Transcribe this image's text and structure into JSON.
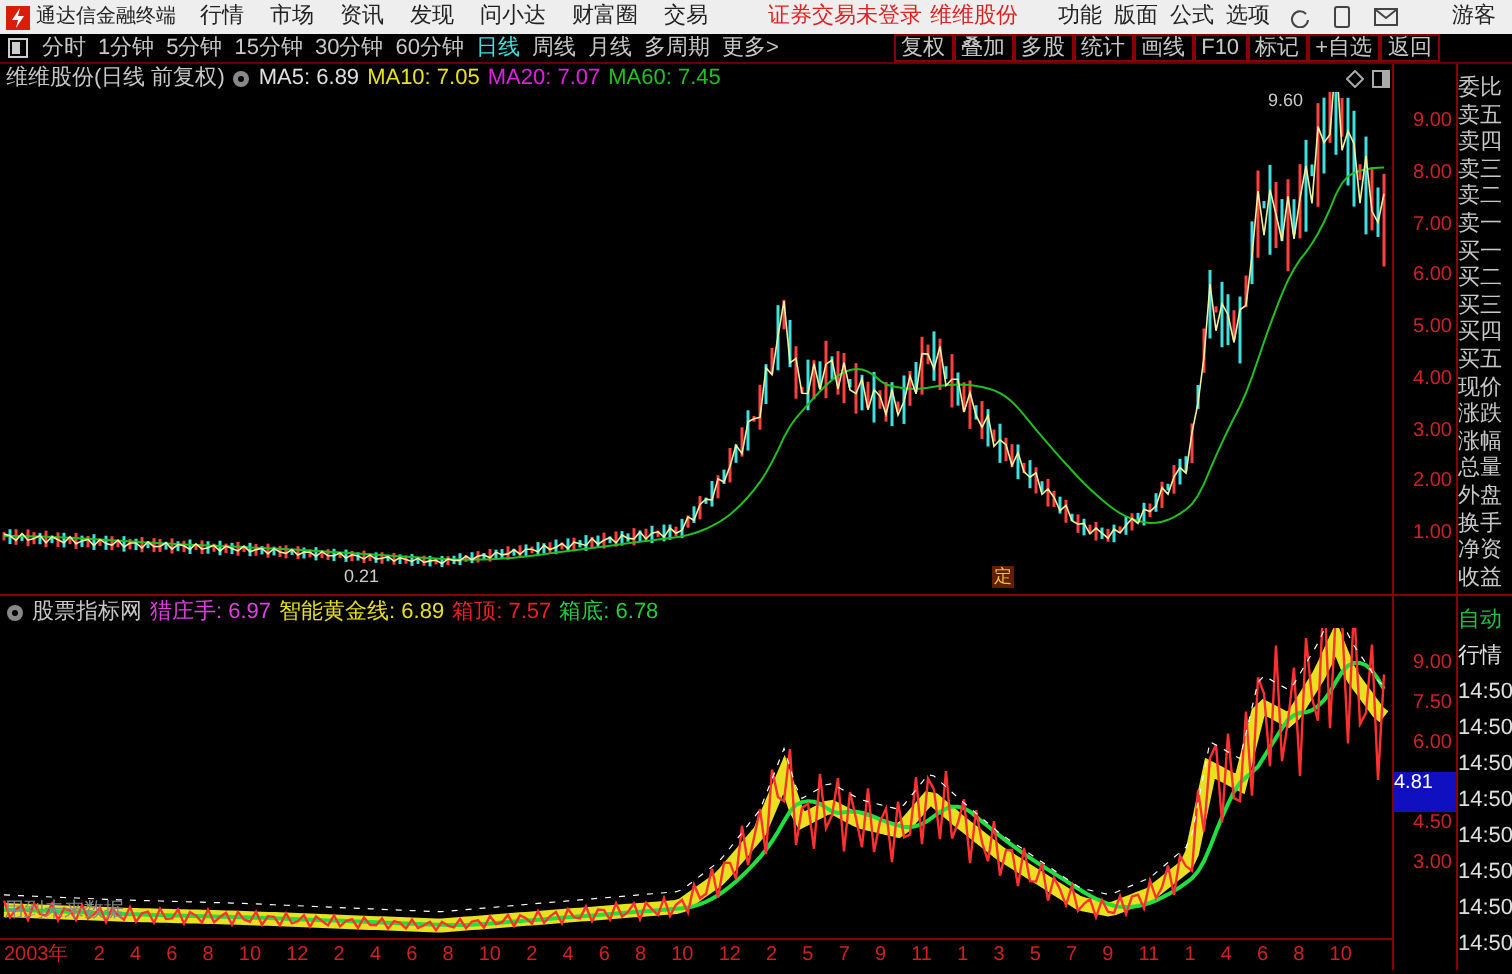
{
  "app": {
    "title": "通达信金融终端",
    "menu": [
      "行情",
      "市场",
      "资讯",
      "发现",
      "问小达",
      "财富圈",
      "交易"
    ],
    "status": "证券交易未登录",
    "stock": "维维股份",
    "tools": [
      "功能",
      "版面",
      "公式",
      "选项"
    ],
    "user": "游客"
  },
  "periods": [
    {
      "label": "分时",
      "selected": false
    },
    {
      "label": "1分钟",
      "selected": false
    },
    {
      "label": "5分钟",
      "selected": false
    },
    {
      "label": "15分钟",
      "selected": false
    },
    {
      "label": "30分钟",
      "selected": false
    },
    {
      "label": "60分钟",
      "selected": false
    },
    {
      "label": "日线",
      "selected": true
    },
    {
      "label": "周线",
      "selected": false
    },
    {
      "label": "月线",
      "selected": false
    },
    {
      "label": "多周期",
      "selected": false
    },
    {
      "label": "更多>",
      "selected": false
    }
  ],
  "actions": [
    "复权",
    "叠加",
    "多股",
    "统计",
    "画线",
    "F10",
    "标记",
    "+自选",
    "返回"
  ],
  "main_chart": {
    "title": "维维股份(日线 前复权)",
    "legend": [
      {
        "name": "MA5:",
        "value": "6.89",
        "color": "#e0e0e0"
      },
      {
        "name": "MA10:",
        "value": "7.05",
        "color": "#e8e020"
      },
      {
        "name": "MA20:",
        "value": "7.07",
        "color": "#e020e0"
      },
      {
        "name": "MA60:",
        "value": "7.45",
        "color": "#20c020"
      }
    ],
    "high_label": "9.60",
    "low_label": "0.21",
    "event_marker": "定",
    "yticks": [
      "9.00",
      "8.00",
      "7.00",
      "6.00",
      "5.00",
      "4.00",
      "3.00",
      "2.00",
      "1.00"
    ]
  },
  "quote_panel": [
    "委比",
    "卖五",
    "卖四",
    "卖三",
    "卖二",
    "卖一",
    "买一",
    "买二",
    "买三",
    "买四",
    "买五",
    "现价",
    "涨跌",
    "涨幅",
    "总量",
    "外盘",
    "换手",
    "净资",
    "收益"
  ],
  "indicator": {
    "source": "股票指标网",
    "legend": [
      {
        "name": "猎庄手:",
        "value": "6.97",
        "color": "#e040e0"
      },
      {
        "name": "智能黄金线:",
        "value": "6.89",
        "color": "#e8e020"
      },
      {
        "name": "箱顶:",
        "value": "7.57",
        "color": "#f02020"
      },
      {
        "name": "箱底:",
        "value": "6.78",
        "color": "#20d040"
      }
    ],
    "note": "用到未来数据",
    "yticks": [
      {
        "label": "9.00",
        "current": false
      },
      {
        "label": "7.50",
        "current": false
      },
      {
        "label": "6.00",
        "current": false
      },
      {
        "label": "4.81",
        "current": true
      },
      {
        "label": "4.50",
        "current": false
      },
      {
        "label": "3.00",
        "current": false
      }
    ]
  },
  "trade_panel": [
    "自动",
    "行情",
    "14:50",
    "14:50",
    "14:50",
    "14:50",
    "14:50",
    "14:50",
    "14:50",
    "14:50"
  ],
  "xaxis": [
    "2003年",
    "2",
    "4",
    "6",
    "8",
    "10",
    "12",
    "2",
    "4",
    "6",
    "8",
    "10",
    "2",
    "4",
    "6",
    "8",
    "10",
    "12",
    "2",
    "5",
    "7",
    "9",
    "11",
    "1",
    "3",
    "5",
    "7",
    "9",
    "11",
    "1",
    "4",
    "6",
    "8",
    "10"
  ]
}
